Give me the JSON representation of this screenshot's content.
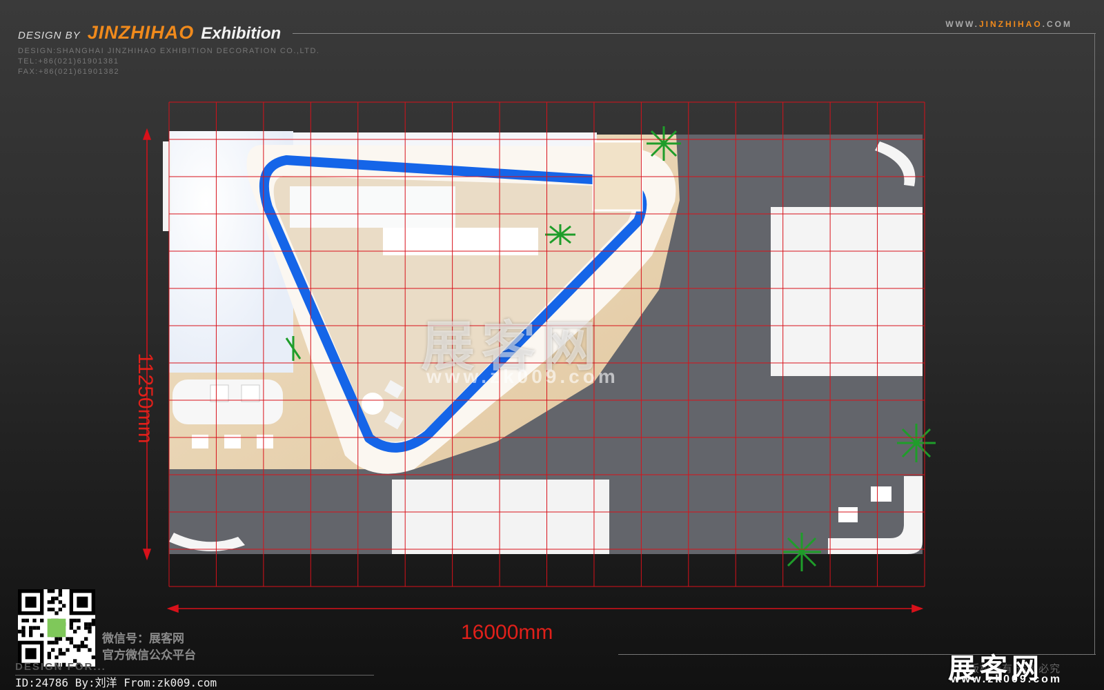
{
  "header": {
    "design_by": "DESIGN BY",
    "brand": "JINZHIHAO",
    "brand_suffix": "Exhibition",
    "company": "DESIGN:SHANGHAI JINZHIHAO EXHIBITION DECORATION CO.,LTD.",
    "tel": "TEL:+86(021)61901381",
    "fax": "FAX:+86(021)61901382",
    "url_pre": "WWW.",
    "url_mid": "JINZHIHAO",
    "url_post": ".COM"
  },
  "dimensions": {
    "width": "16000mm",
    "depth": "11250mm"
  },
  "watermark": {
    "text": "展客网",
    "url": "www.zk009.com"
  },
  "footer": {
    "wechat_id": "微信号：展客网",
    "wechat_desc": "官方微信公众平台",
    "faint": "DESIGN  FOR...",
    "credit": "ID:24786 By:刘洋 From:zk009.com",
    "logo": "展客网",
    "logo_url": "www.zk009.com",
    "copyright": "版权所有 违者必究"
  },
  "colors": {
    "accent": "#f08a1c",
    "grid": "#d8111a",
    "booth_ring": "#1565e8",
    "floor": "#63656b"
  }
}
